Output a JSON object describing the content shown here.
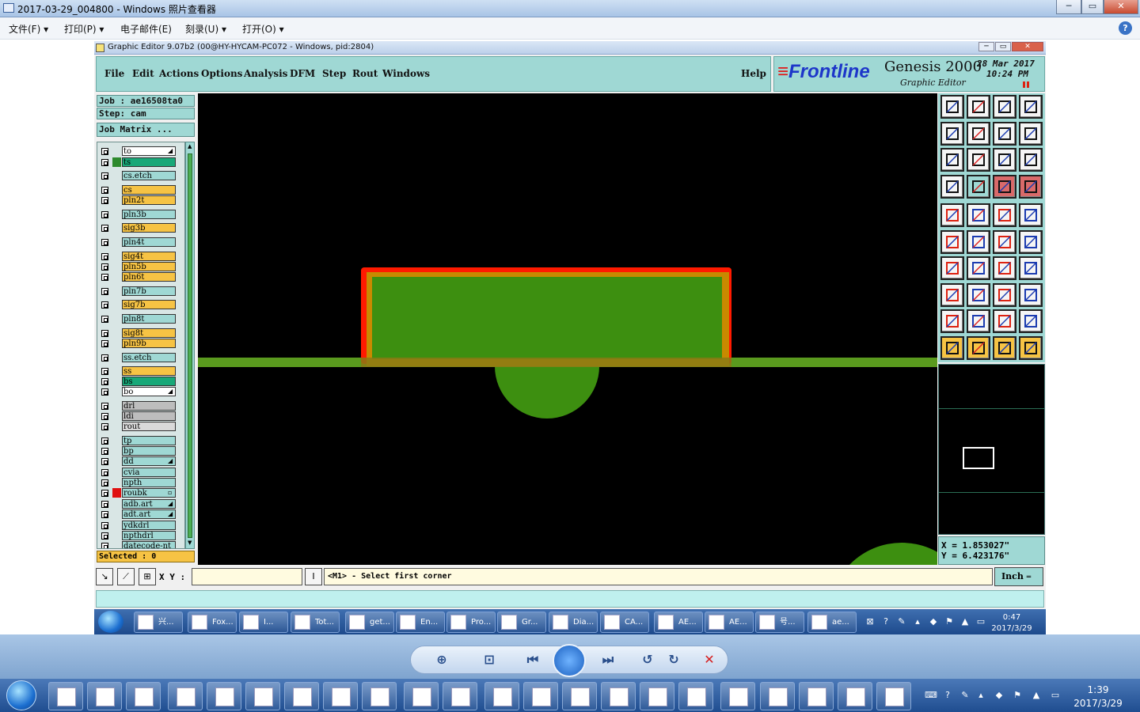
{
  "viewer": {
    "title": "2017-03-29_004800 - Windows 照片查看器",
    "menu": [
      "文件(F)",
      "打印(P)",
      "电子邮件(E)",
      "刻录(U)",
      "打开(O)"
    ],
    "help_icon": "?"
  },
  "ge": {
    "title": "Graphic Editor 9.07b2 (00@HY-HYCAM-PC072 - Windows, pid:2804)",
    "menu": [
      "File",
      "Edit",
      "Actions",
      "Options",
      "Analysis",
      "DFM",
      "Step",
      "Rout",
      "Windows"
    ],
    "help": "Help",
    "logo": {
      "brand": "Frontline",
      "product": "Genesis 2000",
      "subtitle": "Graphic Editor",
      "date": "28 Mar 2017",
      "time": "10:24 PM"
    },
    "job": "Job : ae16508ta0",
    "step": "Step: cam",
    "job_matrix": "Job Matrix ...",
    "layers": [
      {
        "name": "to",
        "color": "#ffffff",
        "mark": "",
        "tag": "◢"
      },
      {
        "name": "ts",
        "color": "#18a878",
        "mark": "#2d8a2d",
        "tag": ""
      },
      {
        "name": "cs.etch",
        "color": "#9fd8d4",
        "mark": "",
        "tag": ""
      },
      {
        "name": "cs",
        "color": "#f6c344",
        "mark": "",
        "tag": ""
      },
      {
        "name": "pln2t",
        "color": "#f6c344",
        "mark": "",
        "tag": ""
      },
      {
        "name": "pln3b",
        "color": "#9fd8d4",
        "mark": "",
        "tag": ""
      },
      {
        "name": "sig3b",
        "color": "#f6c344",
        "mark": "",
        "tag": ""
      },
      {
        "name": "pln4t",
        "color": "#9fd8d4",
        "mark": "",
        "tag": ""
      },
      {
        "name": "sig4t",
        "color": "#f6c344",
        "mark": "",
        "tag": ""
      },
      {
        "name": "pln5b",
        "color": "#f6c344",
        "mark": "",
        "tag": ""
      },
      {
        "name": "pln6t",
        "color": "#f6c344",
        "mark": "",
        "tag": ""
      },
      {
        "name": "pln7b",
        "color": "#9fd8d4",
        "mark": "",
        "tag": ""
      },
      {
        "name": "sig7b",
        "color": "#f6c344",
        "mark": "",
        "tag": ""
      },
      {
        "name": "pln8t",
        "color": "#9fd8d4",
        "mark": "",
        "tag": ""
      },
      {
        "name": "sig8t",
        "color": "#f6c344",
        "mark": "",
        "tag": ""
      },
      {
        "name": "pln9b",
        "color": "#f6c344",
        "mark": "",
        "tag": ""
      },
      {
        "name": "ss.etch",
        "color": "#9fd8d4",
        "mark": "",
        "tag": ""
      },
      {
        "name": "ss",
        "color": "#f6c344",
        "mark": "",
        "tag": ""
      },
      {
        "name": "bs",
        "color": "#18a878",
        "mark": "",
        "tag": ""
      },
      {
        "name": "bo",
        "color": "#ffffff",
        "mark": "",
        "tag": "◢"
      },
      {
        "name": "drl",
        "color": "#bdbdbd",
        "mark": "",
        "tag": ""
      },
      {
        "name": "ldi",
        "color": "#bdbdbd",
        "mark": "",
        "tag": ""
      },
      {
        "name": "rout",
        "color": "#d9d9d9",
        "mark": "",
        "tag": ""
      },
      {
        "name": "tp",
        "color": "#9fd8d4",
        "mark": "",
        "tag": ""
      },
      {
        "name": "bp",
        "color": "#9fd8d4",
        "mark": "",
        "tag": ""
      },
      {
        "name": "dd",
        "color": "#9fd8d4",
        "mark": "",
        "tag": "◢"
      },
      {
        "name": "cvia",
        "color": "#9fd8d4",
        "mark": "",
        "tag": ""
      },
      {
        "name": "npth",
        "color": "#9fd8d4",
        "mark": "",
        "tag": ""
      },
      {
        "name": "roubk",
        "color": "#9fd8d4",
        "mark": "#e01010",
        "tag": "▫"
      },
      {
        "name": "adb.art",
        "color": "#9fd8d4",
        "mark": "",
        "tag": "◢"
      },
      {
        "name": "adt.art",
        "color": "#9fd8d4",
        "mark": "",
        "tag": "◢"
      },
      {
        "name": "ydkdrl",
        "color": "#9fd8d4",
        "mark": "",
        "tag": ""
      },
      {
        "name": "npthdrl",
        "color": "#9fd8d4",
        "mark": "",
        "tag": ""
      },
      {
        "name": "datecode-nt",
        "color": "#9fd8d4",
        "mark": "",
        "tag": ""
      }
    ],
    "selected": "Selected : 0",
    "coords": {
      "x": "X = 1.853027\"",
      "y": "Y = 6.423176\""
    },
    "xy_label": "X Y :",
    "xy_value": "",
    "prompt": "<M1> - Select first corner",
    "units": "Inch",
    "units_arrow": "═",
    "colors": {
      "panel": "#9fd8d4",
      "canvas": "#000000",
      "copper": "#3d8f10",
      "outline": "#ff1a00",
      "pad_edge": "#c88a00"
    }
  },
  "inner_taskbar": {
    "items": [
      "兴...",
      "Fox...",
      "I...",
      "Tot...",
      "get...",
      "En...",
      "Pro...",
      "Gr...",
      "Dia...",
      "CA...",
      "AE...",
      "AE...",
      "号...",
      "ae..."
    ],
    "time": "0:47",
    "date": "2017/3/29"
  },
  "taskbar": {
    "time": "1:39",
    "date": "2017/3/29"
  }
}
